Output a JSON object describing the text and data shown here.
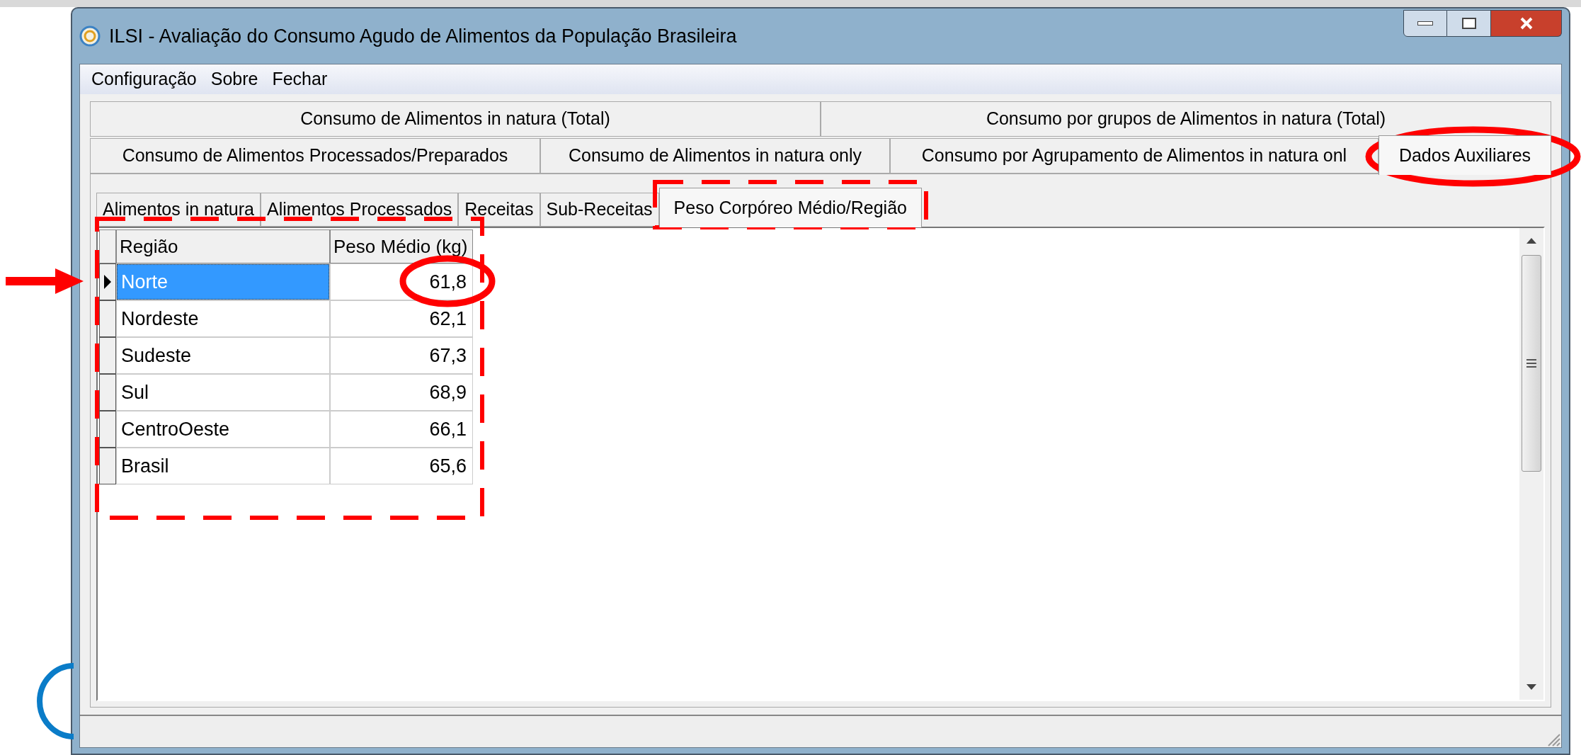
{
  "window": {
    "title": "ILSI - Avaliação do Consumo Agudo de Alimentos da População Brasileira"
  },
  "menu": [
    "Configuração",
    "Sobre",
    "Fechar"
  ],
  "tab_rows": [
    [
      {
        "label": "Consumo de Alimentos in natura (Total)",
        "selected": false
      },
      {
        "label": "Consumo por grupos de Alimentos in natura (Total)",
        "selected": false
      }
    ],
    [
      {
        "label": "Consumo de Alimentos Processados/Preparados",
        "selected": false
      },
      {
        "label": "Consumo de Alimentos in natura only",
        "selected": false
      },
      {
        "label": "Consumo por Agrupamento de Alimentos in natura onl",
        "selected": false
      },
      {
        "label": "Dados Auxiliares",
        "selected": true
      }
    ]
  ],
  "sub_tabs": [
    {
      "label": "Alimentos in natura",
      "selected": false
    },
    {
      "label": "Alimentos Processados",
      "selected": false
    },
    {
      "label": "Receitas",
      "selected": false
    },
    {
      "label": "Sub-Receitas",
      "selected": false
    },
    {
      "label": "Peso Corpóreo Médio/Região",
      "selected": true
    }
  ],
  "grid": {
    "columns": [
      "Região",
      "Peso Médio (kg)"
    ],
    "rows": [
      {
        "regiao": "Norte",
        "peso": "61,8",
        "selected": true
      },
      {
        "regiao": "Nordeste",
        "peso": "62,1",
        "selected": false
      },
      {
        "regiao": "Sudeste",
        "peso": "67,3",
        "selected": false
      },
      {
        "regiao": "Sul",
        "peso": "68,9",
        "selected": false
      },
      {
        "regiao": "CentroOeste",
        "peso": "66,1",
        "selected": false
      },
      {
        "regiao": "Brasil",
        "peso": "65,6",
        "selected": false
      }
    ]
  },
  "annotations": [
    {
      "kind": "arrow"
    },
    {
      "kind": "dashed_box"
    },
    {
      "kind": "dashed_box"
    },
    {
      "kind": "ellipse"
    },
    {
      "kind": "ellipse"
    },
    {
      "kind": "arc"
    }
  ]
}
